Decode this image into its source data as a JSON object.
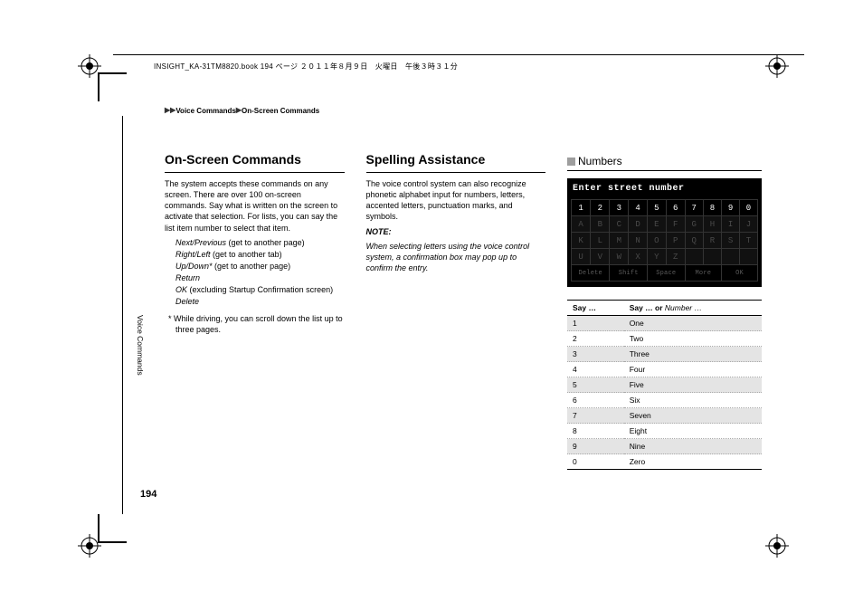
{
  "book_info": "INSIGHT_KA-31TM8820.book  194 ページ  ２０１１年８月９日　火曜日　午後３時３１分",
  "breadcrumb": {
    "a": "Voice Commands",
    "b": "On-Screen Commands"
  },
  "side_tab": "Voice Commands",
  "page_number": "194",
  "col1": {
    "heading": "On-Screen Commands",
    "para": "The system accepts these commands on any screen. There are over 100 on-screen commands. Say what is written on the screen to activate that selection. For lists, you can say the list item number to select that item.",
    "cmds": [
      {
        "i": "Next/Previous",
        "n": " (get to another page)"
      },
      {
        "i": "Right/Left",
        "n": " (get to another tab)"
      },
      {
        "i": "Up/Down*",
        "n": " (get to another page)"
      },
      {
        "i": "Return",
        "n": ""
      },
      {
        "i": "OK",
        "n": " (excluding Startup Confirmation screen)"
      },
      {
        "i": "Delete",
        "n": ""
      }
    ],
    "foot": "*  While driving, you can scroll down the list up to three pages."
  },
  "col2": {
    "heading": "Spelling Assistance",
    "para": "The voice control system can also recognize phonetic alphabet input for numbers, letters, accented letters, punctuation marks, and symbols.",
    "note_label": "NOTE:",
    "note_body": "When selecting letters using the voice control system, a confirmation box may pop up to confirm the entry."
  },
  "col3": {
    "section": "Numbers",
    "kp_title": "Enter street number",
    "kp_nums": [
      "1",
      "2",
      "3",
      "4",
      "5",
      "6",
      "7",
      "8",
      "9",
      "0"
    ],
    "kp_row2": [
      "A",
      "B",
      "C",
      "D",
      "E",
      "F",
      "G",
      "H",
      "I",
      "J"
    ],
    "kp_row3": [
      "K",
      "L",
      "M",
      "N",
      "O",
      "P",
      "Q",
      "R",
      "S",
      "T"
    ],
    "kp_row4": [
      "U",
      "V",
      "W",
      "X",
      "Y",
      "Z",
      "",
      "",
      "",
      ""
    ],
    "kp_labels": [
      "Delete",
      "Shift",
      "Space",
      "More",
      "OK"
    ],
    "table_head": {
      "c1": "Say …",
      "c2a": "Say … or ",
      "c2b": "Number …"
    },
    "rows": [
      {
        "a": "1",
        "b": "One"
      },
      {
        "a": "2",
        "b": "Two"
      },
      {
        "a": "3",
        "b": "Three"
      },
      {
        "a": "4",
        "b": "Four"
      },
      {
        "a": "5",
        "b": "Five"
      },
      {
        "a": "6",
        "b": "Six"
      },
      {
        "a": "7",
        "b": "Seven"
      },
      {
        "a": "8",
        "b": "Eight"
      },
      {
        "a": "9",
        "b": "Nine"
      },
      {
        "a": "0",
        "b": "Zero"
      }
    ]
  }
}
